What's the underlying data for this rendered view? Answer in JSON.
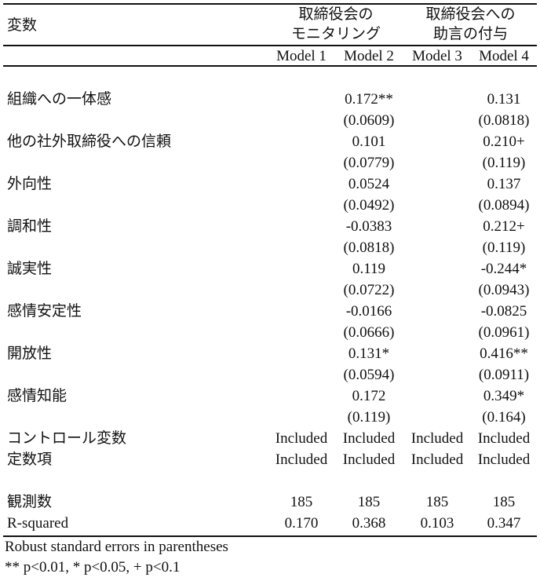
{
  "header": {
    "variable_label": "変数",
    "group1_line1": "取締役会の",
    "group1_line2": "モニタリング",
    "group2_line1": "取締役会への",
    "group2_line2": "助言の付与",
    "models": [
      "Model 1",
      "Model 2",
      "Model 3",
      "Model 4"
    ]
  },
  "rows": [
    {
      "label": "組織への一体感",
      "coef": [
        "",
        "0.172**",
        "",
        "0.131"
      ],
      "se": [
        "",
        "(0.0609)",
        "",
        "(0.0818)"
      ]
    },
    {
      "label": "他の社外取締役への信頼",
      "coef": [
        "",
        "0.101",
        "",
        "0.210+"
      ],
      "se": [
        "",
        "(0.0779)",
        "",
        "(0.119)"
      ]
    },
    {
      "label": "外向性",
      "coef": [
        "",
        "0.0524",
        "",
        "0.137"
      ],
      "se": [
        "",
        "(0.0492)",
        "",
        "(0.0894)"
      ]
    },
    {
      "label": "調和性",
      "coef": [
        "",
        "-0.0383",
        "",
        "0.212+"
      ],
      "se": [
        "",
        "(0.0818)",
        "",
        "(0.119)"
      ]
    },
    {
      "label": "誠実性",
      "coef": [
        "",
        "0.119",
        "",
        "-0.244*"
      ],
      "se": [
        "",
        "(0.0722)",
        "",
        "(0.0943)"
      ]
    },
    {
      "label": "感情安定性",
      "coef": [
        "",
        "-0.0166",
        "",
        "-0.0825"
      ],
      "se": [
        "",
        "(0.0666)",
        "",
        "(0.0961)"
      ]
    },
    {
      "label": "開放性",
      "coef": [
        "",
        "0.131*",
        "",
        "0.416**"
      ],
      "se": [
        "",
        "(0.0594)",
        "",
        "(0.0911)"
      ]
    },
    {
      "label": "感情知能",
      "coef": [
        "",
        "0.172",
        "",
        "0.349*"
      ],
      "se": [
        "",
        "(0.119)",
        "",
        "(0.164)"
      ]
    }
  ],
  "controls": [
    {
      "label": "コントロール変数",
      "values": [
        "Included",
        "Included",
        "Included",
        "Included"
      ]
    },
    {
      "label": "定数項",
      "values": [
        "Included",
        "Included",
        "Included",
        "Included"
      ]
    }
  ],
  "stats": [
    {
      "label": "観測数",
      "values": [
        "185",
        "185",
        "185",
        "185"
      ]
    },
    {
      "label": "R-squared",
      "values": [
        "0.170",
        "0.368",
        "0.103",
        "0.347"
      ]
    }
  ],
  "notes": [
    "Robust standard errors in parentheses",
    "** p<0.01, * p<0.05, + p<0.1"
  ]
}
